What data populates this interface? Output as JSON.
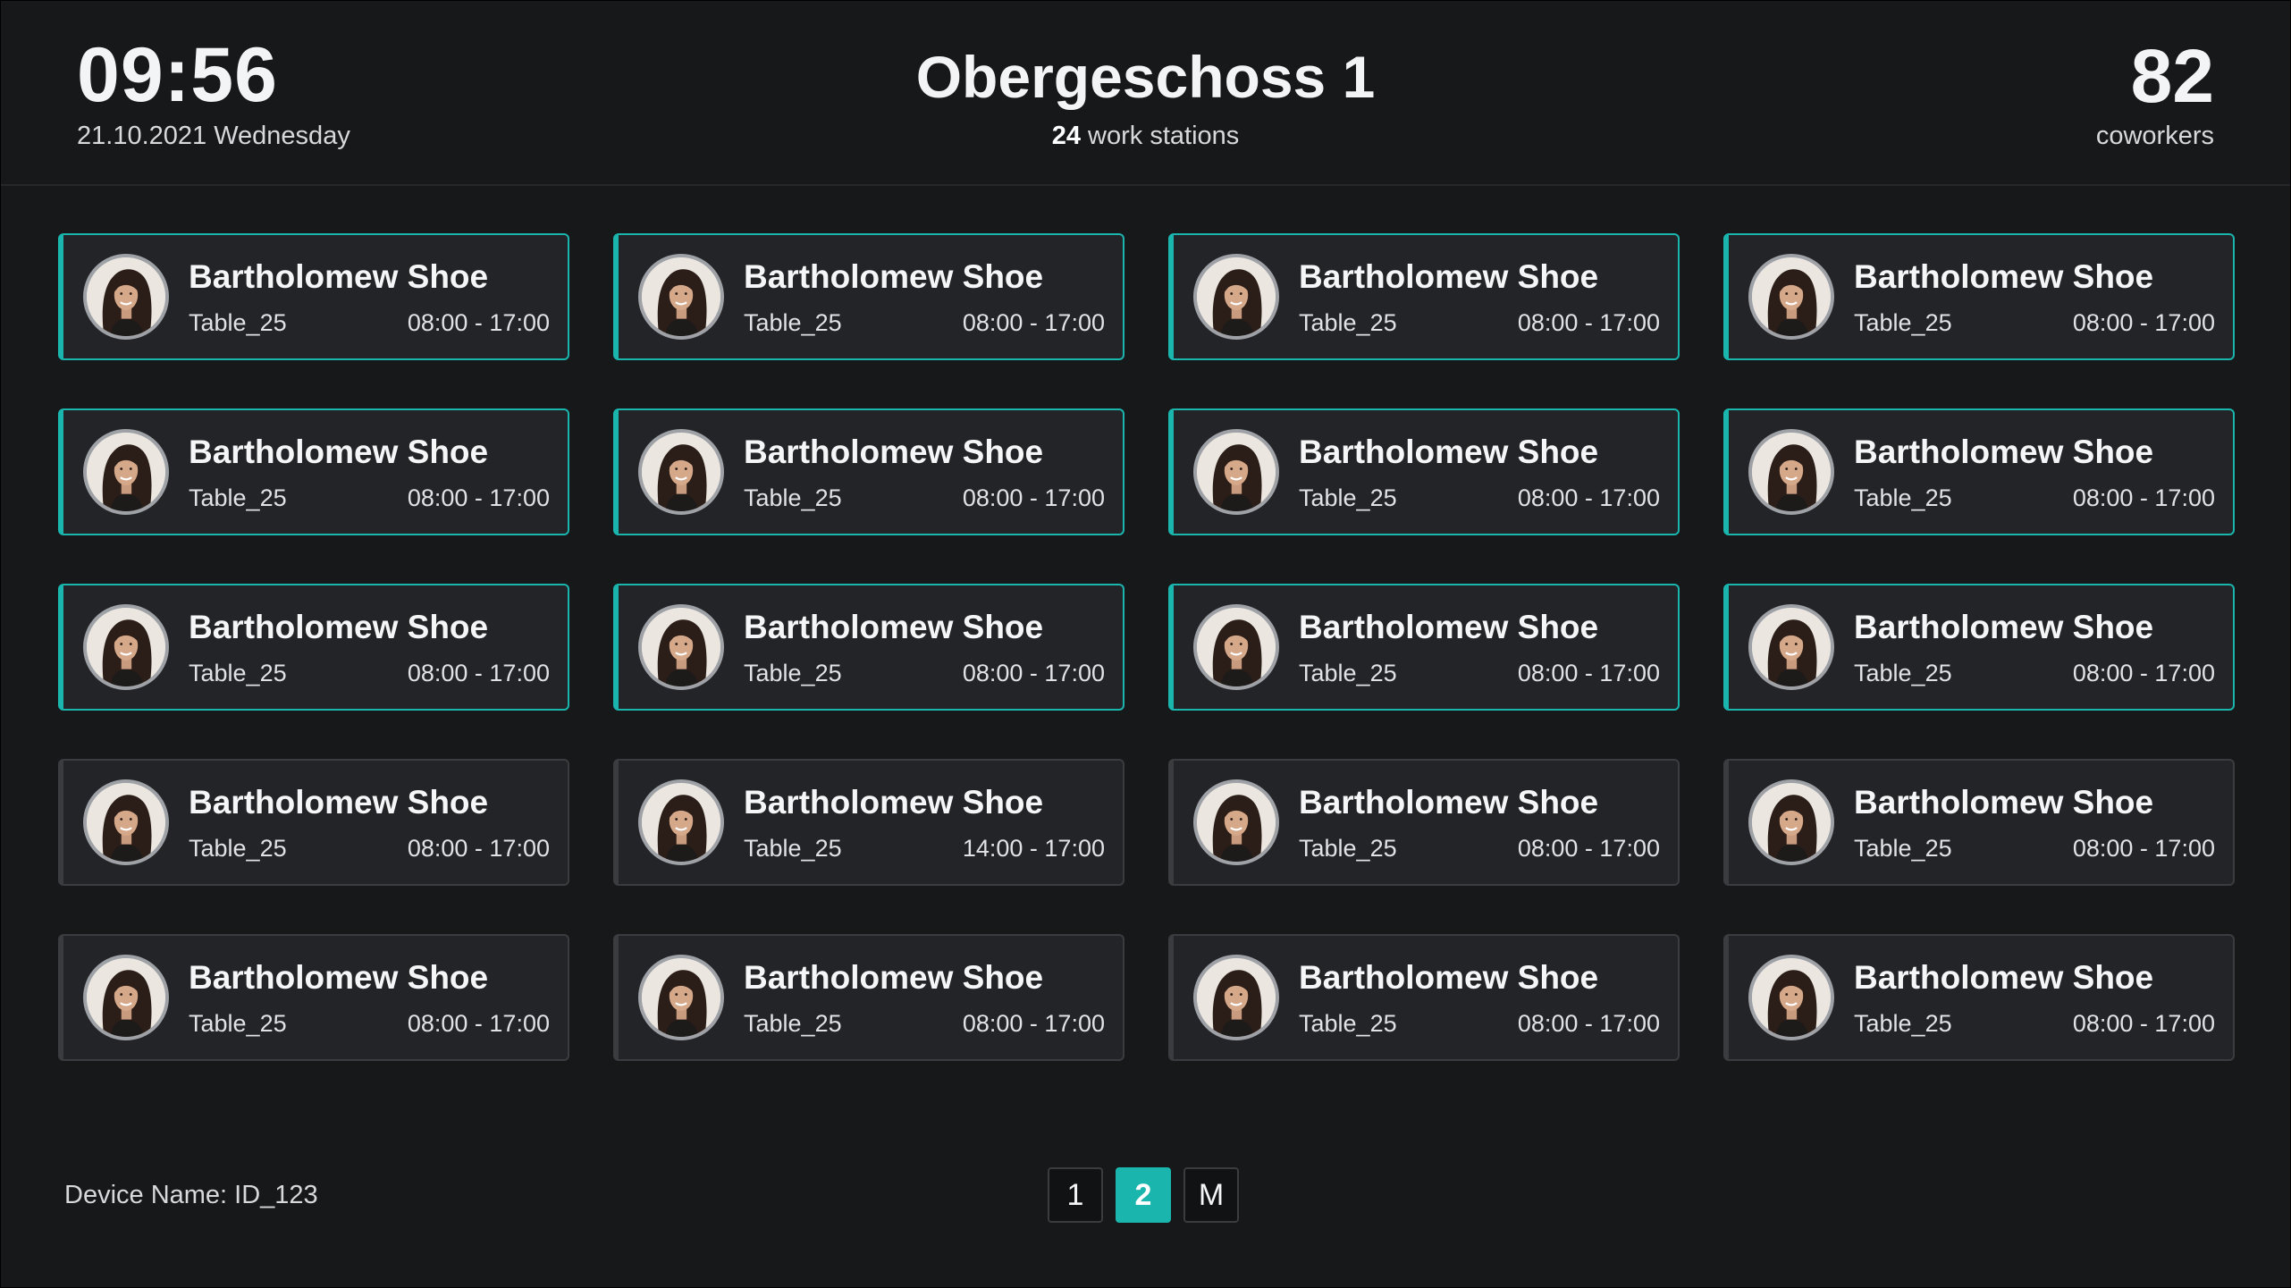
{
  "header": {
    "time": "09:56",
    "date": "21.10.2021 Wednesday",
    "floor": "Obergeschoss 1",
    "workstations_count": "24",
    "workstations_label": "work stations",
    "coworkers_count": "82",
    "coworkers_label": "coworkers"
  },
  "accent_color": "#1ab5ad",
  "cards": [
    {
      "name": "Bartholomew Shoe",
      "table": "Table_25",
      "time": "08:00 - 17:00",
      "active": true
    },
    {
      "name": "Bartholomew Shoe",
      "table": "Table_25",
      "time": "08:00 - 17:00",
      "active": true
    },
    {
      "name": "Bartholomew Shoe",
      "table": "Table_25",
      "time": "08:00 - 17:00",
      "active": true
    },
    {
      "name": "Bartholomew Shoe",
      "table": "Table_25",
      "time": "08:00 - 17:00",
      "active": true
    },
    {
      "name": "Bartholomew Shoe",
      "table": "Table_25",
      "time": "08:00 - 17:00",
      "active": true
    },
    {
      "name": "Bartholomew Shoe",
      "table": "Table_25",
      "time": "08:00 - 17:00",
      "active": true
    },
    {
      "name": "Bartholomew Shoe",
      "table": "Table_25",
      "time": "08:00 - 17:00",
      "active": true
    },
    {
      "name": "Bartholomew Shoe",
      "table": "Table_25",
      "time": "08:00 - 17:00",
      "active": true
    },
    {
      "name": "Bartholomew Shoe",
      "table": "Table_25",
      "time": "08:00 - 17:00",
      "active": true
    },
    {
      "name": "Bartholomew Shoe",
      "table": "Table_25",
      "time": "08:00 - 17:00",
      "active": true
    },
    {
      "name": "Bartholomew Shoe",
      "table": "Table_25",
      "time": "08:00 - 17:00",
      "active": true
    },
    {
      "name": "Bartholomew Shoe",
      "table": "Table_25",
      "time": "08:00 - 17:00",
      "active": true
    },
    {
      "name": "Bartholomew Shoe",
      "table": "Table_25",
      "time": "08:00 - 17:00",
      "active": false
    },
    {
      "name": "Bartholomew Shoe",
      "table": "Table_25",
      "time": "14:00 - 17:00",
      "active": false
    },
    {
      "name": "Bartholomew Shoe",
      "table": "Table_25",
      "time": "08:00 - 17:00",
      "active": false
    },
    {
      "name": "Bartholomew Shoe",
      "table": "Table_25",
      "time": "08:00 - 17:00",
      "active": false
    },
    {
      "name": "Bartholomew Shoe",
      "table": "Table_25",
      "time": "08:00 - 17:00",
      "active": false
    },
    {
      "name": "Bartholomew Shoe",
      "table": "Table_25",
      "time": "08:00 - 17:00",
      "active": false
    },
    {
      "name": "Bartholomew Shoe",
      "table": "Table_25",
      "time": "08:00 - 17:00",
      "active": false
    },
    {
      "name": "Bartholomew Shoe",
      "table": "Table_25",
      "time": "08:00 - 17:00",
      "active": false
    }
  ],
  "footer": {
    "device": "Device Name: ID_123",
    "pages": [
      {
        "label": "1",
        "current": false
      },
      {
        "label": "2",
        "current": true
      },
      {
        "label": "M",
        "current": false
      }
    ]
  }
}
